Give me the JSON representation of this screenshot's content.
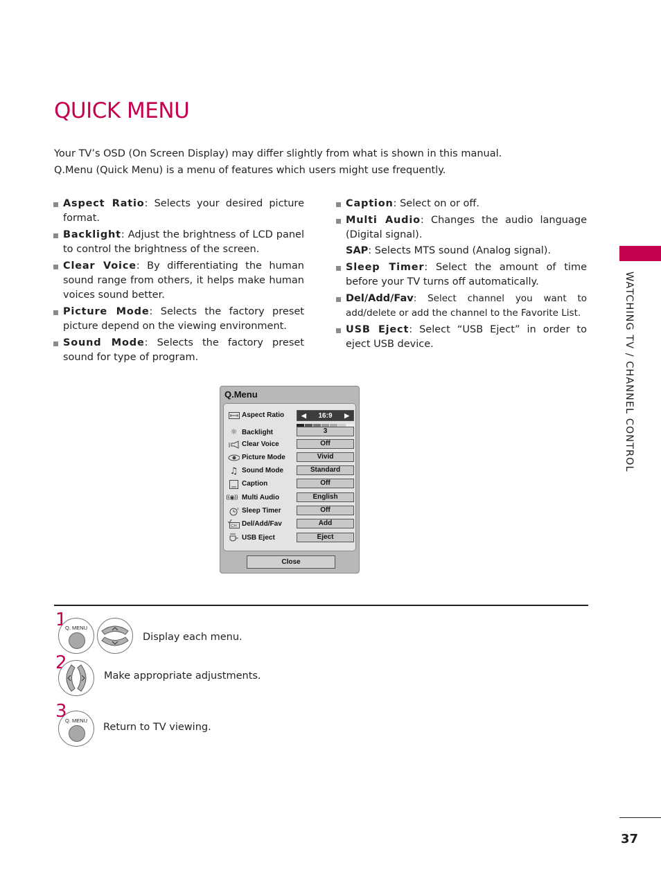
{
  "page": {
    "title": "QUICK MENU",
    "intro": [
      "Your TV’s OSD (On Screen Display) may differ slightly from what is shown in this manual.",
      "Q.Menu (Quick Menu) is a menu of features which users might use frequently."
    ],
    "side_tab": "WATCHING TV / CHANNEL CONTROL",
    "page_number": "37",
    "accent_color": "#c4004f"
  },
  "features_left": [
    {
      "term": "Aspect Ratio",
      "desc": ": Selects your desired picture format."
    },
    {
      "term": "Backlight",
      "desc": ": Adjust the brightness of LCD panel to control the brightness of the screen."
    },
    {
      "term": "Clear Voice",
      "desc": ": By differentiating the human sound range from others, it helps make human voices sound better."
    },
    {
      "term": "Picture Mode",
      "desc": ": Selects the factory preset picture depend on the viewing environment."
    },
    {
      "term": "Sound Mode",
      "desc": ": Selects the factory preset sound for type of program."
    }
  ],
  "features_right": [
    {
      "term": "Caption",
      "desc": ": Select on or off."
    },
    {
      "term": "Multi Audio",
      "desc": ": Changes the audio language (Digital signal)."
    },
    {
      "term": "SAP",
      "desc": ": Selects MTS sound (Analog signal)."
    },
    {
      "term": "Sleep Timer",
      "desc": ": Select the amount of time before your TV turns off automatically."
    },
    {
      "term": "Del/Add/Fav",
      "desc": ": Select channel you want to add/delete or add the channel to the Favorite List."
    },
    {
      "term": "USB Eject",
      "desc": ": Select “USB Eject” in order to eject USB device."
    }
  ],
  "osd": {
    "title": "Q.Menu",
    "rows": [
      {
        "icon": "aspect-ratio-icon",
        "label": "Aspect Ratio",
        "value": "16:9",
        "selected": true
      },
      {
        "icon": "backlight-icon",
        "label": "Backlight",
        "value": "3",
        "level_fraction": 0.3
      },
      {
        "icon": "clear-voice-icon",
        "label": "Clear Voice",
        "value": "Off"
      },
      {
        "icon": "picture-mode-icon",
        "label": "Picture Mode",
        "value": "Vivid"
      },
      {
        "icon": "sound-mode-icon",
        "label": "Sound Mode",
        "value": "Standard"
      },
      {
        "icon": "caption-icon",
        "label": "Caption",
        "value": "Off"
      },
      {
        "icon": "multi-audio-icon",
        "label": "Multi Audio",
        "value": "English"
      },
      {
        "icon": "sleep-timer-icon",
        "label": "Sleep Timer",
        "value": "Off"
      },
      {
        "icon": "del-add-fav-icon",
        "label": "Del/Add/Fav",
        "value": "Add"
      },
      {
        "icon": "usb-eject-icon",
        "label": "USB Eject",
        "value": "Eject"
      }
    ],
    "close_label": "Close",
    "arrow_left": "◀",
    "arrow_right": "▶"
  },
  "steps": [
    {
      "number": "1",
      "button_label": "Q. MENU",
      "text": "Display each menu."
    },
    {
      "number": "2",
      "text": "Make appropriate adjustments."
    },
    {
      "number": "3",
      "button_label": "Q. MENU",
      "text": "Return to TV viewing."
    }
  ]
}
